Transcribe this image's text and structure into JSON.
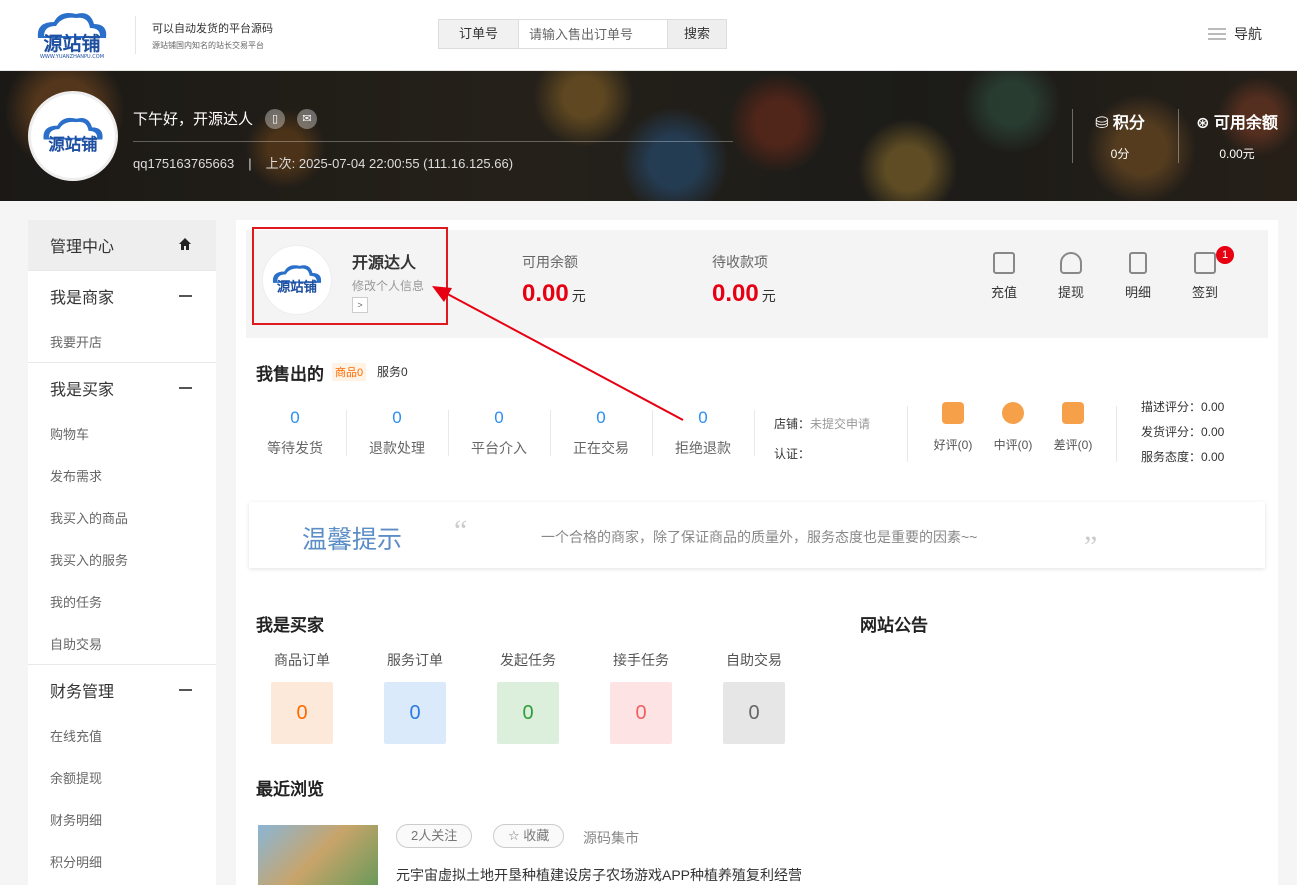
{
  "header": {
    "brand": "源站铺",
    "brand_url": "WWW.YUANZHANPU.COM",
    "slogan": "可以自动发货的平台源码",
    "sub_slogan": "源站铺国内知名的站长交易平台",
    "search_label": "订单号",
    "search_placeholder": "请输入售出订单号",
    "search_button": "搜索",
    "nav_label": "导航"
  },
  "banner": {
    "greeting": "下午好，开源达人",
    "account": "qq175163765663",
    "separator": "|",
    "last_login": "上次: 2025-07-04 22:00:55 (111.16.125.66)",
    "points_label": "积分",
    "points_value": "0分",
    "balance_label": "可用余额",
    "balance_value": "0.00元"
  },
  "sidebar": {
    "home_label": "管理中心",
    "groups": [
      {
        "title": "我是商家",
        "items": [
          "我要开店"
        ]
      },
      {
        "title": "我是买家",
        "items": [
          "购物车",
          "发布需求",
          "我买入的商品",
          "我买入的服务",
          "我的任务",
          "自助交易"
        ]
      },
      {
        "title": "财务管理",
        "items": [
          "在线充值",
          "余额提现",
          "财务明细",
          "积分明细"
        ]
      }
    ]
  },
  "summary": {
    "username": "开源达人",
    "edit_profile": "修改个人信息",
    "arrow": ">",
    "available_label": "可用余额",
    "available_amount": "0.00",
    "pending_label": "待收款项",
    "pending_amount": "0.00",
    "currency": "元",
    "actions": [
      "充值",
      "提现",
      "明细",
      "签到"
    ],
    "sign_badge": "1"
  },
  "sold": {
    "title": "我售出的",
    "goods_tag": "商品0",
    "service_tag": "服务0",
    "stats": [
      {
        "value": "0",
        "label": "等待发货"
      },
      {
        "value": "0",
        "label": "退款处理"
      },
      {
        "value": "0",
        "label": "平台介入"
      },
      {
        "value": "0",
        "label": "正在交易"
      },
      {
        "value": "0",
        "label": "拒绝退款"
      }
    ],
    "store_label": "店铺：",
    "store_status": "未提交申请",
    "cert_label": "认证：",
    "ratings": [
      "好评(0)",
      "中评(0)",
      "差评(0)"
    ],
    "scores": [
      "描述评分：0.00",
      "发货评分：0.00",
      "服务态度：0.00"
    ]
  },
  "tip": {
    "title": "温馨提示",
    "open_quote": "“",
    "close_quote": "”",
    "text": "一个合格的商家，除了保证商品的质量外，服务态度也是重要的因素~~"
  },
  "buyer": {
    "title": "我是买家",
    "items": [
      {
        "label": "商品订单",
        "value": "0",
        "bg": "#fde9d9",
        "fg": "#ff6a00"
      },
      {
        "label": "服务订单",
        "value": "0",
        "bg": "#dbeafb",
        "fg": "#2a7ae2"
      },
      {
        "label": "发起任务",
        "value": "0",
        "bg": "#dcefdc",
        "fg": "#2e9e3a"
      },
      {
        "label": "接手任务",
        "value": "0",
        "bg": "#fde3e3",
        "fg": "#f06060"
      },
      {
        "label": "自助交易",
        "value": "0",
        "bg": "#e6e6e6",
        "fg": "#666666"
      }
    ]
  },
  "notice_title": "网站公告",
  "recent": {
    "title": "最近浏览",
    "followers": "2人关注",
    "favorite": "收藏",
    "source": "源码集市",
    "item_title": "元宇宙虚拟土地开垦种植建设房子农场游戏APP种植养殖复利经营"
  },
  "colors": {
    "accent_red": "#e60012",
    "link_blue": "#2a8ef2",
    "tip_blue": "#5b8ec6",
    "highlight_border": "#e0191f"
  }
}
